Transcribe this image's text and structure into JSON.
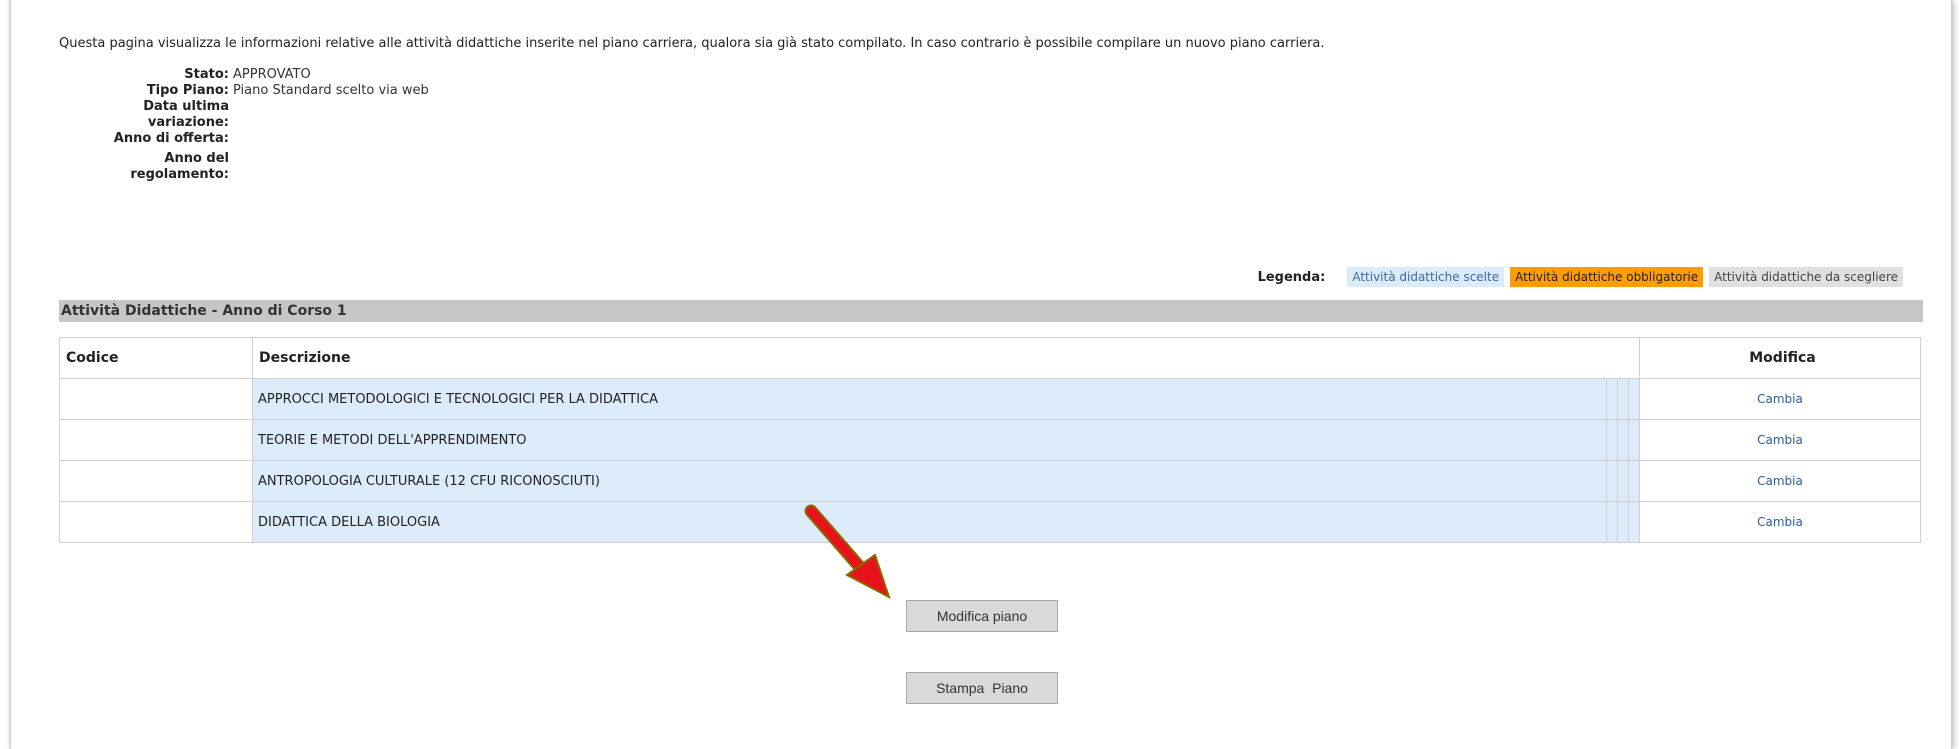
{
  "intro_text": "Questa pagina visualizza le informazioni relative alle attività didattiche inserite nel piano carriera, qualora sia già stato compilato. In caso contrario è possibile compilare un nuovo piano carriera.",
  "info": [
    {
      "label": "Stato:",
      "value": "APPROVATO"
    },
    {
      "label": "Tipo Piano:",
      "value": "Piano Standard scelto via web"
    },
    {
      "label": "Data ultima variazione:",
      "value": ""
    },
    {
      "label": "Anno di offerta:",
      "value": ""
    },
    {
      "label": "Anno del regolamento:",
      "value": ""
    }
  ],
  "legend": {
    "title": "Legenda:",
    "chosen": "Attività didattiche scelte",
    "mandatory": "Attività didattiche obbligatorie",
    "to_choose": "Attività didattiche da scegliere"
  },
  "section_title": "Attività Didattiche - Anno di Corso 1",
  "table": {
    "headers": {
      "code": "Codice",
      "description": "Descrizione",
      "modify": "Modifica"
    },
    "rows": [
      {
        "code": "",
        "description": "APPROCCI METODOLOGICI E TECNOLOGICI PER LA DIDATTICA",
        "action": "Cambia"
      },
      {
        "code": "",
        "description": "TEORIE E METODI DELL'APPRENDIMENTO",
        "action": "Cambia"
      },
      {
        "code": "",
        "description": "ANTROPOLOGIA CULTURALE (12 CFU RICONOSCIUTI)",
        "action": "Cambia"
      },
      {
        "code": "",
        "description": "DIDATTICA DELLA BIOLOGIA",
        "action": "Cambia"
      }
    ]
  },
  "buttons": {
    "modify_plan": "Modifica piano",
    "print_plan": "Stampa  Piano"
  },
  "colors": {
    "chosen_bg": "#dcebf9",
    "mandatory_bg": "#ff9c00",
    "to_choose_bg": "#e0e0e0",
    "arrow": "#e8121a"
  }
}
